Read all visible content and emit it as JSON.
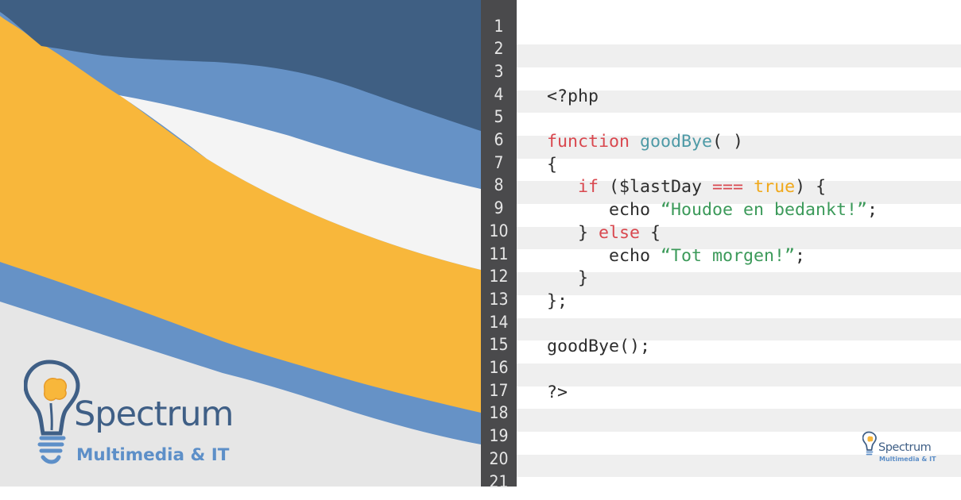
{
  "brand": {
    "name": "Spectrum",
    "tagline": "Multimedia & IT"
  },
  "colors": {
    "dark_blue": "#3f5f83",
    "mid_blue": "#6692c6",
    "offwhite": "#f4f4f4",
    "yellow": "#f8b73b",
    "light_gray": "#e6e6e6",
    "gutter": "#4a4a4c",
    "keyword": "#d9484f",
    "function_name": "#4e9aa6",
    "boolean": "#f0a81a",
    "string": "#3c9a5a"
  },
  "editor": {
    "line_numbers": [
      "1",
      "2",
      "3",
      "4",
      "5",
      "6",
      "7",
      "8",
      "9",
      "10",
      "11",
      "12",
      "13",
      "14",
      "15",
      "16",
      "17",
      "18",
      "19",
      "20",
      "21"
    ],
    "lines": [
      {
        "n": "1",
        "tokens": []
      },
      {
        "n": "2",
        "tokens": []
      },
      {
        "n": "3",
        "tokens": []
      },
      {
        "n": "4",
        "tokens": [
          {
            "t": "<?php",
            "c": "pl"
          }
        ]
      },
      {
        "n": "5",
        "tokens": []
      },
      {
        "n": "6",
        "tokens": [
          {
            "t": "function",
            "c": "kw"
          },
          {
            "t": " ",
            "c": "pl"
          },
          {
            "t": "goodBye",
            "c": "fn"
          },
          {
            "t": "( )",
            "c": "pl"
          }
        ]
      },
      {
        "n": "7",
        "tokens": [
          {
            "t": "{",
            "c": "pl"
          }
        ]
      },
      {
        "n": "8",
        "tokens": [
          {
            "t": "   ",
            "c": "pl"
          },
          {
            "t": "if",
            "c": "kw"
          },
          {
            "t": " ($lastDay ",
            "c": "pl"
          },
          {
            "t": "===",
            "c": "kw"
          },
          {
            "t": " ",
            "c": "pl"
          },
          {
            "t": "true",
            "c": "tr"
          },
          {
            "t": ") {",
            "c": "pl"
          }
        ]
      },
      {
        "n": "9",
        "tokens": [
          {
            "t": "      echo ",
            "c": "pl"
          },
          {
            "t": "“Houdoe en bedankt!”",
            "c": "str"
          },
          {
            "t": ";",
            "c": "pl"
          }
        ]
      },
      {
        "n": "10",
        "tokens": [
          {
            "t": "   } ",
            "c": "pl"
          },
          {
            "t": "else",
            "c": "kw"
          },
          {
            "t": " {",
            "c": "pl"
          }
        ]
      },
      {
        "n": "11",
        "tokens": [
          {
            "t": "      echo ",
            "c": "pl"
          },
          {
            "t": "“Tot morgen!”",
            "c": "str"
          },
          {
            "t": ";",
            "c": "pl"
          }
        ]
      },
      {
        "n": "12",
        "tokens": [
          {
            "t": "   }",
            "c": "pl"
          }
        ]
      },
      {
        "n": "13",
        "tokens": [
          {
            "t": "};",
            "c": "pl"
          }
        ]
      },
      {
        "n": "14",
        "tokens": []
      },
      {
        "n": "15",
        "tokens": [
          {
            "t": "goodBye();",
            "c": "pl"
          }
        ]
      },
      {
        "n": "16",
        "tokens": []
      },
      {
        "n": "17",
        "tokens": [
          {
            "t": "?>",
            "c": "pl"
          }
        ]
      },
      {
        "n": "18",
        "tokens": []
      },
      {
        "n": "19",
        "tokens": []
      },
      {
        "n": "20",
        "tokens": []
      },
      {
        "n": "21",
        "tokens": []
      }
    ]
  },
  "icons": {
    "logo_icon": "lightbulb-brain-icon"
  }
}
